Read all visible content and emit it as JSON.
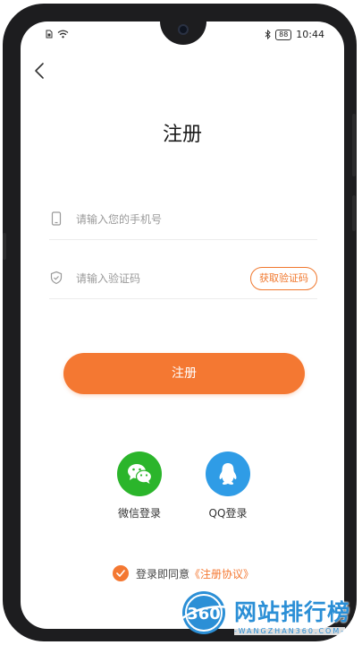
{
  "status_bar": {
    "time": "10:44",
    "battery": "88"
  },
  "page": {
    "title": "注册"
  },
  "form": {
    "phone_placeholder": "请输入您的手机号",
    "code_placeholder": "请输入验证码",
    "get_code_label": "获取验证码",
    "register_label": "注册"
  },
  "social": {
    "wechat_label": "微信登录",
    "qq_label": "QQ登录"
  },
  "agreement": {
    "text": "登录即同意",
    "link": "《注册协议》",
    "checked": true
  },
  "watermark": {
    "logo_text": "360",
    "title": "网站排行榜",
    "domain": "-WANGZHAN360.COM-"
  },
  "colors": {
    "accent": "#f47832",
    "wechat": "#2bb52b",
    "qq": "#2f9ce6",
    "watermark": "#2b8fd6"
  }
}
